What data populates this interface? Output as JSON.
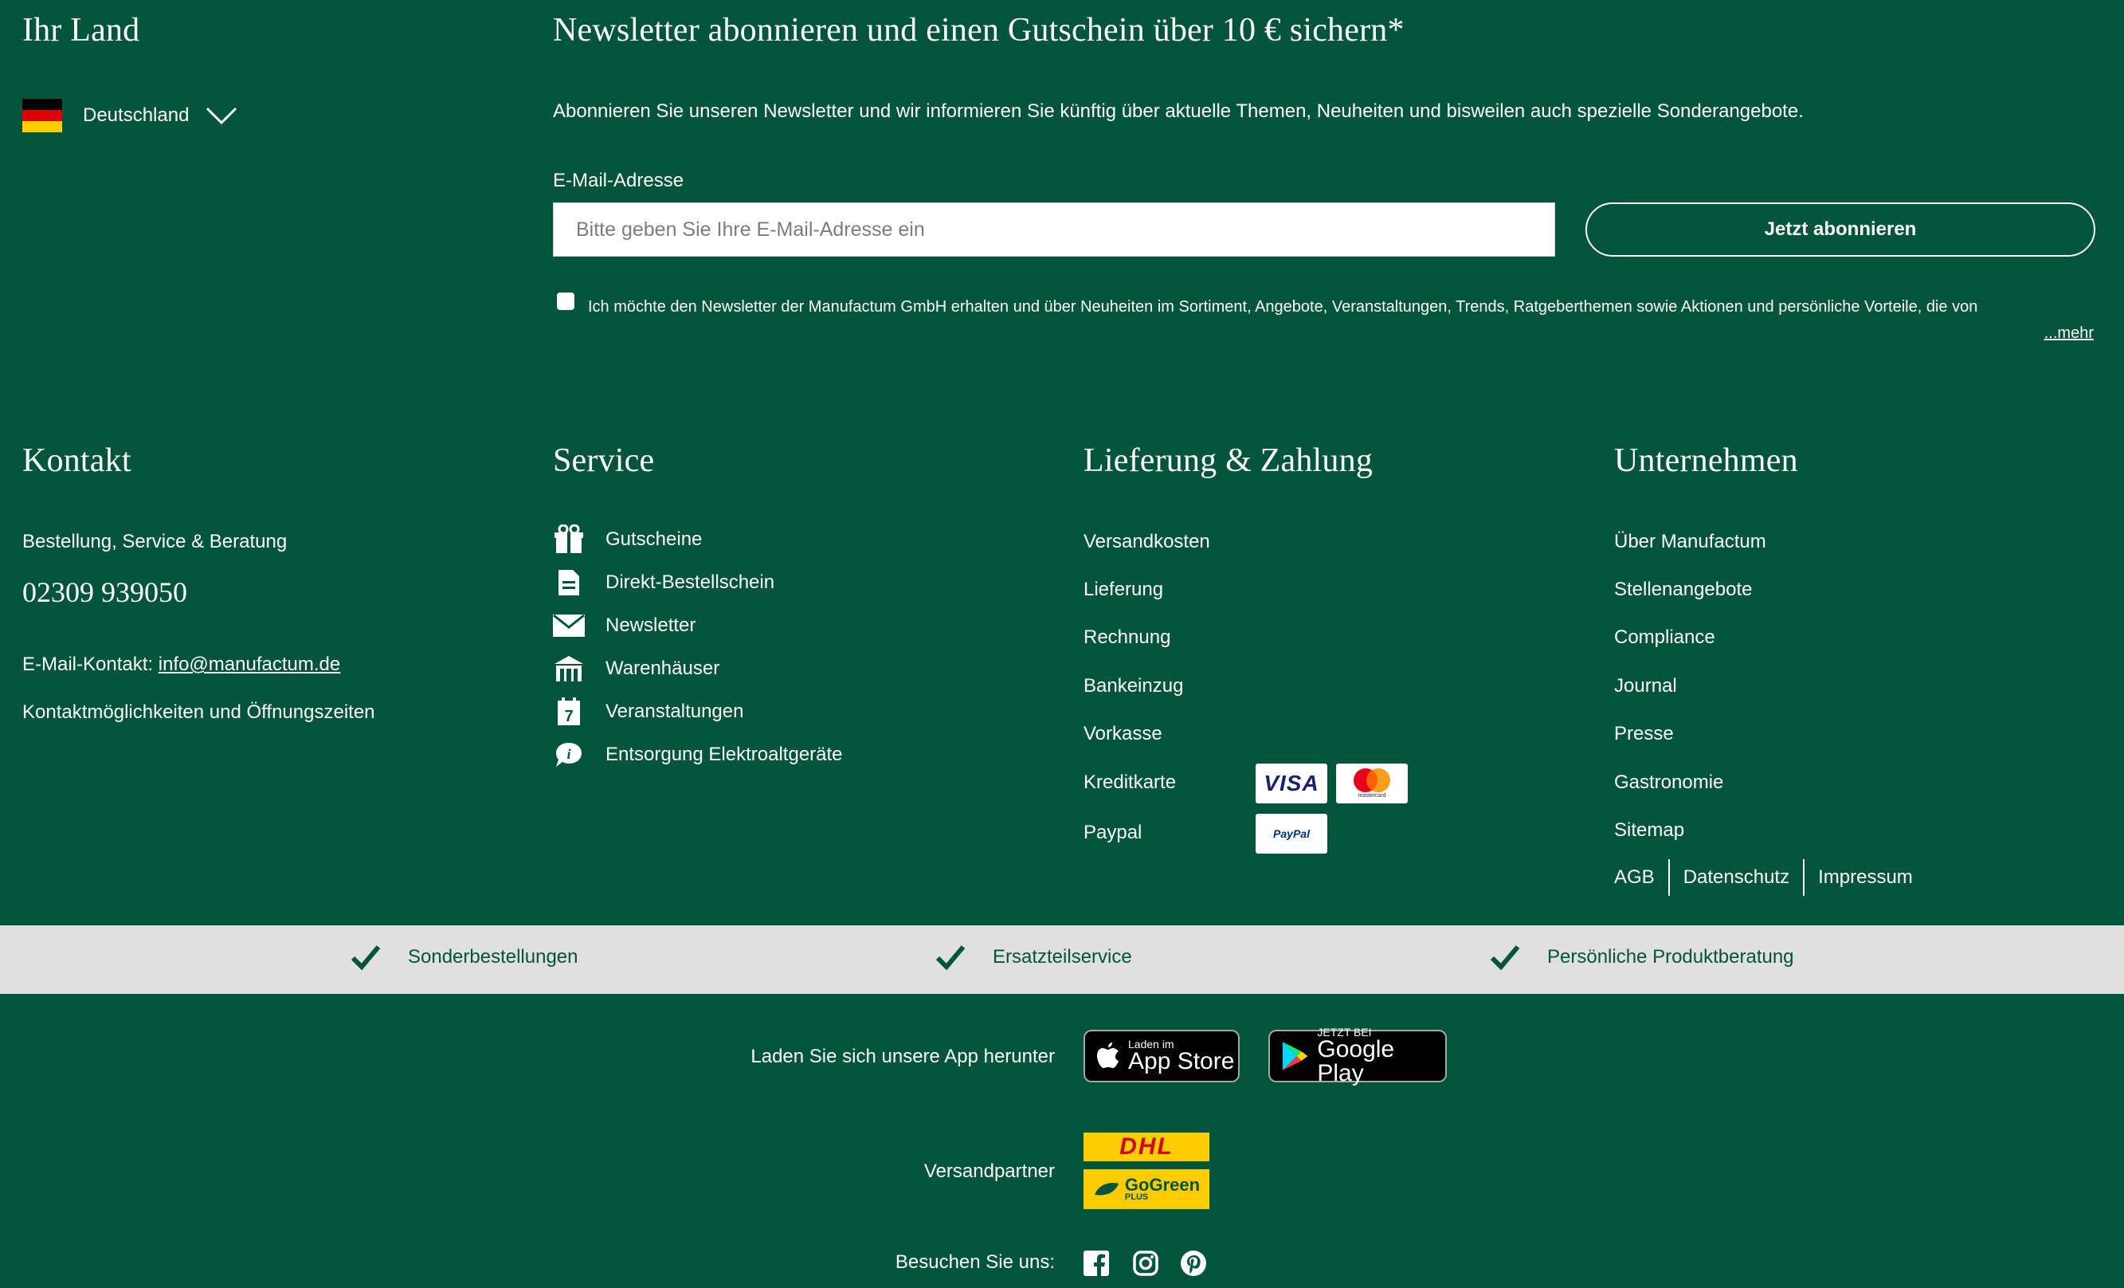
{
  "country": {
    "heading": "Ihr Land",
    "selected": "Deutschland"
  },
  "newsletter": {
    "heading": "Newsletter abonnieren und einen Gutschein über 10 € sichern*",
    "intro": "Abonnieren Sie unseren Newsletter und wir informieren Sie künftig über aktuelle Themen, Neuheiten und bisweilen auch spezielle Sonderangebote.",
    "email_label": "E-Mail-Adresse",
    "email_placeholder": "Bitte geben Sie Ihre E-Mail-Adresse ein",
    "email_value": "",
    "subscribe_label": "Jetzt abonnieren",
    "consent_text": "Ich möchte den Newsletter der Manufactum GmbH erhalten und über Neuheiten im Sortiment, Angebote, Veranstaltungen, Trends, Ratgeberthemen sowie Aktionen und persönliche Vorteile, die von",
    "more_label": "...mehr"
  },
  "contact": {
    "heading": "Kontakt",
    "order_label": "Bestellung, Service & Beratung",
    "phone": "02309 939050",
    "email_prefix": "E-Mail-Kontakt:",
    "email": "info@manufactum.de",
    "hours_link": "Kontaktmöglichkeiten und Öffnungszeiten"
  },
  "service": {
    "heading": "Service",
    "items": [
      {
        "label": "Gutscheine",
        "icon": "gift-icon"
      },
      {
        "label": "Direkt-Bestellschein",
        "icon": "document-icon"
      },
      {
        "label": "Newsletter",
        "icon": "envelope-icon"
      },
      {
        "label": "Warenhäuser",
        "icon": "store-icon"
      },
      {
        "label": "Veranstaltungen",
        "icon": "calendar-icon"
      },
      {
        "label": "Entsorgung Elektroaltgeräte",
        "icon": "info-bubble-icon"
      }
    ]
  },
  "delivery": {
    "heading": "Lieferung & Zahlung",
    "items": [
      "Versandkosten",
      "Lieferung",
      "Rechnung",
      "Bankeinzug",
      "Vorkasse",
      "Kreditkarte",
      "Paypal"
    ],
    "visa": "VISA",
    "mastercard": "mastercard",
    "paypal": "PayPal"
  },
  "company": {
    "heading": "Unternehmen",
    "items": [
      "Über Manufactum",
      "Stellenangebote",
      "Compliance",
      "Journal",
      "Presse",
      "Gastronomie",
      "Sitemap"
    ],
    "legal": [
      "AGB",
      "Datenschutz",
      "Impressum"
    ]
  },
  "usp": [
    "Sonderbestellungen",
    "Ersatzteilservice",
    "Persönliche Produktberatung"
  ],
  "app": {
    "label": "Laden Sie sich unsere App herunter",
    "appstore_small": "Laden im",
    "appstore_big": "App Store",
    "googleplay_small": "JETZT BEI",
    "googleplay_big": "Google Play"
  },
  "shipping": {
    "label": "Versandpartner",
    "dhl": "DHL",
    "gogreen": "GoGreen",
    "gogreen_sub": "PLUS"
  },
  "social": {
    "label": "Besuchen Sie uns:",
    "icons": [
      "facebook-icon",
      "instagram-icon",
      "pinterest-icon"
    ]
  },
  "colors": {
    "background": "#02553a",
    "usp_bar": "#e0e0e0",
    "dhl_yellow": "#ffcc00",
    "dhl_red": "#d40511"
  }
}
